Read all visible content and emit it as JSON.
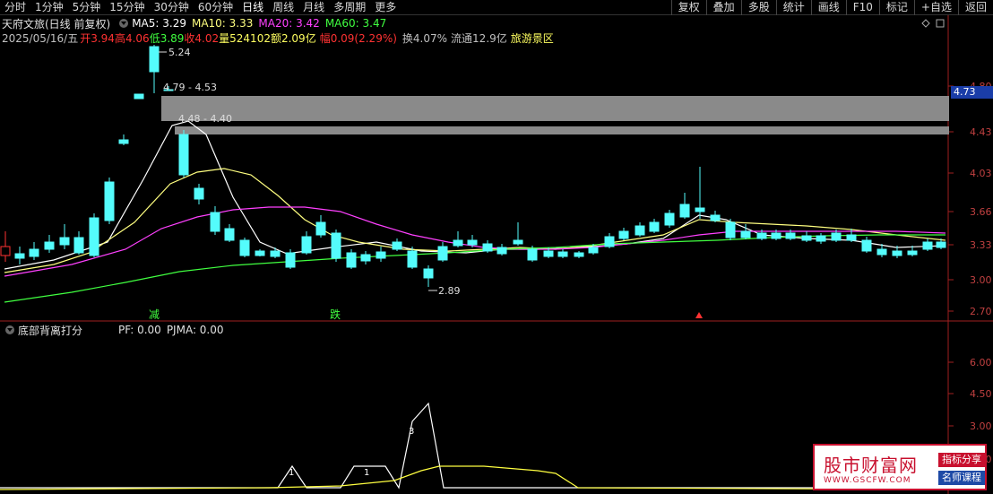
{
  "toolbar": {
    "left": [
      "分时",
      "1分钟",
      "5分钟",
      "15分钟",
      "30分钟",
      "60分钟",
      "日线",
      "周线",
      "月线",
      "多周期",
      "更多"
    ],
    "active": "日线",
    "right": [
      "复权",
      "叠加",
      "多股",
      "统计",
      "画线",
      "F10",
      "标记",
      "+自选",
      "返回"
    ]
  },
  "header": {
    "stock": "天府文旅(日线 前复权)",
    "ma5": "MA5: 3.29",
    "ma10": "MA10: 3.33",
    "ma20": "MA20: 3.42",
    "ma60": "MA60: 3.47",
    "date": "2025/05/16/五",
    "open": "开3.94",
    "high": "高4.06",
    "low": "低3.89",
    "close": "收4.02",
    "volume": "量524102",
    "amount": "额2.09亿",
    "change": "幅0.09(2.29%)",
    "turnover": "换4.07%",
    "float": "流通12.9亿",
    "sector": "旅游景区"
  },
  "colors": {
    "up": "#ff3232",
    "down": "#54fcfc",
    "ma5": "#ffffff",
    "ma10": "#ffff80",
    "ma20": "#ff40ff",
    "ma60": "#40ff40"
  },
  "axis": {
    "upper": [
      "4.80",
      "4.43",
      "4.03",
      "3.66",
      "3.33",
      "3.00",
      "2.70"
    ],
    "lower": [
      "6.00",
      "4.50",
      "3.00",
      "1.50"
    ]
  },
  "price_tag": "4.73",
  "annotations": {
    "high": "5.24",
    "zone1": "4.79 - 4.53",
    "zone2": "4.48 - 4.40",
    "low": "2.89",
    "mark1": "减",
    "mark2": "跌"
  },
  "indicator": {
    "name": "底部背离打分",
    "pf": "PF: 0.00",
    "pjma": "PJMA: 0.00",
    "peak_labels": [
      "1",
      "1",
      "3"
    ]
  },
  "watermark": {
    "main": "股市财富网",
    "url": "WWW.GSCFW.COM",
    "badge1": "指标分享",
    "badge2": "名师课程"
  }
}
